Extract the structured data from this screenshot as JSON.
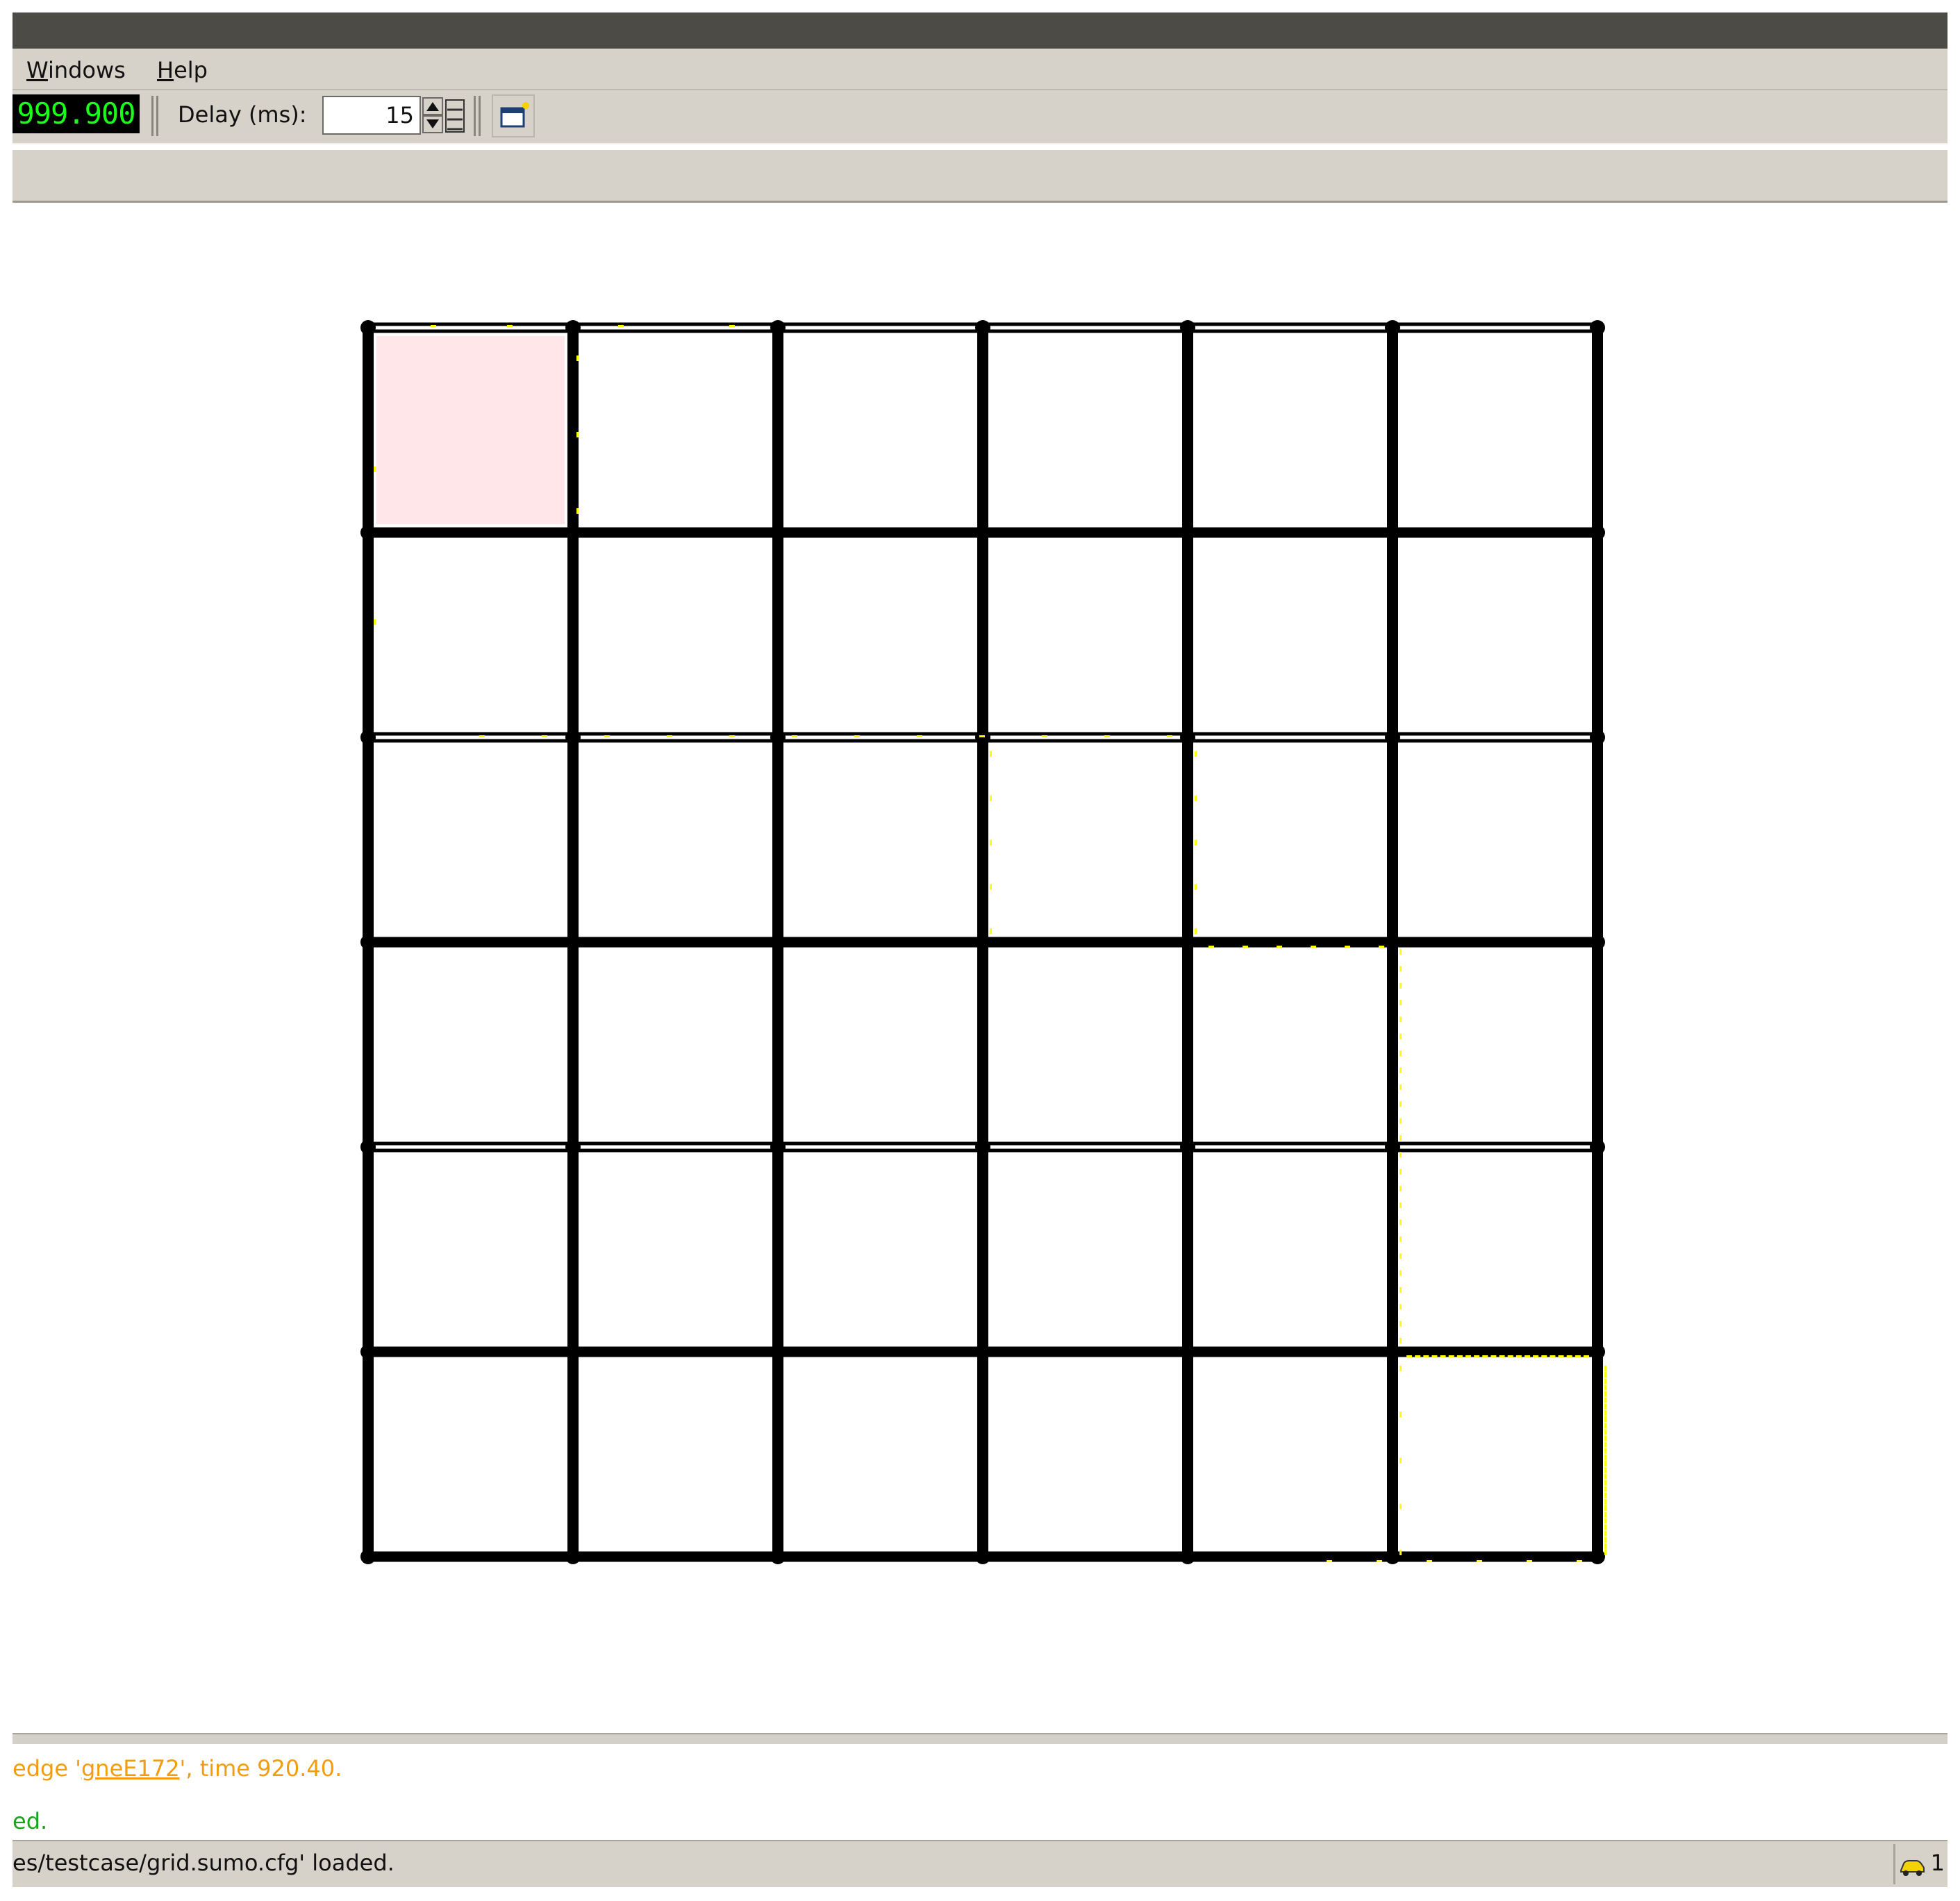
{
  "menu": {
    "items": [
      {
        "label": "Windows",
        "accel": "W",
        "rest": "indows"
      },
      {
        "label": "Help",
        "accel": "H",
        "rest": "elp"
      }
    ]
  },
  "toolbar": {
    "sim_time": "999.900",
    "delay_label": "Delay (ms):",
    "delay_value": "15",
    "open_view_icon": "new-view-icon"
  },
  "network": {
    "grid_cols": 6,
    "grid_rows": 6,
    "highlighted_cell": "row 1, col 1",
    "colors": {
      "road": "#000000",
      "vehicle": "#ffff00",
      "highlight": "#ffe6e8",
      "background": "#ffffff"
    }
  },
  "messages": [
    {
      "prefix": "edge '",
      "link": "gneE172",
      "suffix": "', time 920.40.",
      "color": "#f29c10"
    },
    {
      "text": "ed.",
      "color": "#1aa31a"
    }
  ],
  "status": {
    "text": "es/testcase/grid.sumo.cfg' loaded.",
    "vehicle_count": "1"
  }
}
